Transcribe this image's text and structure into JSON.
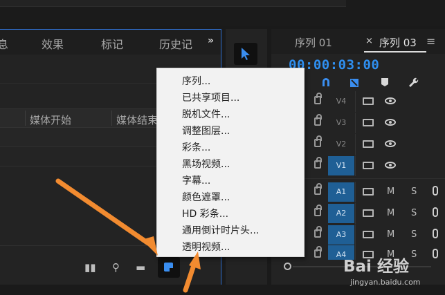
{
  "project_panel": {
    "tabs": [
      "息",
      "效果",
      "标记",
      "历史记"
    ],
    "overflow_icon": "chevron-double-right-icon",
    "columns": [
      "媒体开始",
      "媒体结束"
    ],
    "bottom_icons": [
      "storyboard-icon",
      "search-icon",
      "folder-icon",
      "new-item-icon"
    ]
  },
  "tools": {
    "active_tool": "selection-arrow-icon"
  },
  "timeline": {
    "tabs": [
      {
        "label": "序列 01",
        "active": false
      },
      {
        "label": "序列 03",
        "active": true
      }
    ],
    "close_icon": "×",
    "menu_icon": "≡",
    "timecode": "00:00:03:00",
    "toolbar_icons": [
      "snap-magnet-icon",
      "linked-selection-icon",
      "add-marker-icon",
      "wrench-icon"
    ],
    "video_tracks": [
      {
        "name": "V4",
        "targeted": false
      },
      {
        "name": "V3",
        "targeted": false
      },
      {
        "name": "V2",
        "targeted": false
      },
      {
        "name": "V1",
        "targeted": true
      }
    ],
    "audio_tracks": [
      {
        "name": "A1",
        "targeted": true,
        "mute": "M",
        "solo": "S"
      },
      {
        "name": "A2",
        "targeted": true,
        "mute": "M",
        "solo": "S"
      },
      {
        "name": "A3",
        "targeted": true,
        "mute": "M",
        "solo": "S"
      },
      {
        "name": "A4",
        "targeted": true,
        "mute": "M",
        "solo": "S"
      }
    ]
  },
  "context_menu": {
    "items": [
      "序列...",
      "已共享项目...",
      "脱机文件...",
      "调整图层...",
      "彩条...",
      "黑场视频...",
      "字幕...",
      "颜色遮罩...",
      "HD 彩条...",
      "通用倒计时片头...",
      "透明视频..."
    ]
  },
  "colors": {
    "accent": "#2f8ff0",
    "menu_bg": "#f2f2f2",
    "arrow": "#f28b30",
    "track_on": "#1f5f95"
  },
  "watermark": {
    "main": "Bai 经验",
    "sub": "jingyan.baidu.com"
  }
}
